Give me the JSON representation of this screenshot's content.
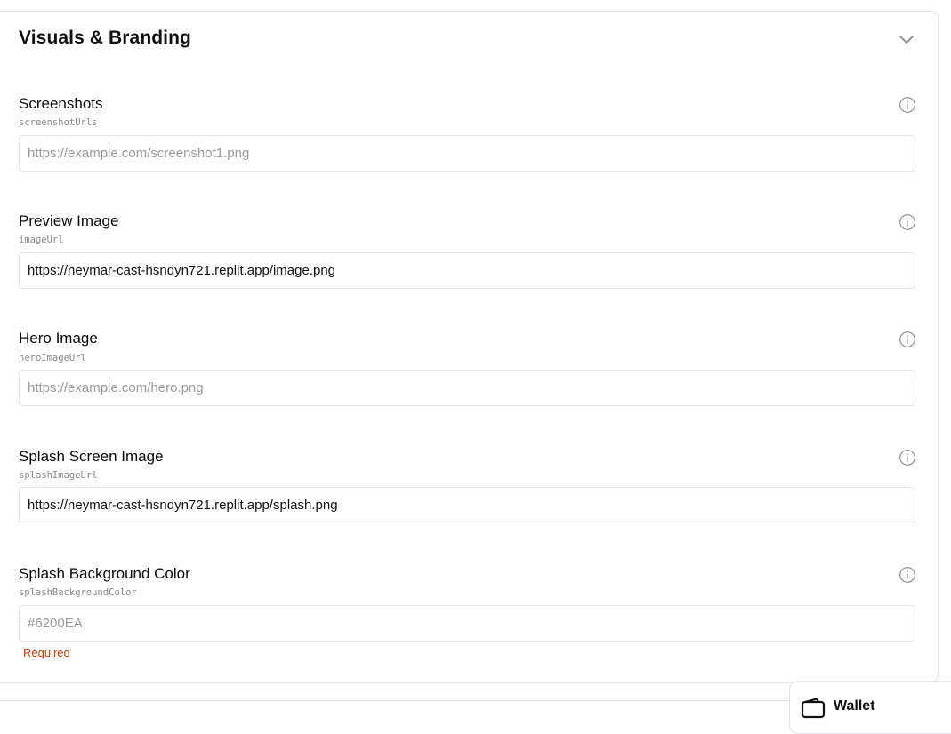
{
  "section": {
    "title": "Visuals & Branding"
  },
  "fields": [
    {
      "label": "Screenshots",
      "key": "screenshotUrls",
      "value": "",
      "placeholder": "https://example.com/screenshot1.png"
    },
    {
      "label": "Preview Image",
      "key": "imageUrl",
      "value": "https://neymar-cast-hsndyn721.replit.app/image.png",
      "placeholder": ""
    },
    {
      "label": "Hero Image",
      "key": "heroImageUrl",
      "value": "",
      "placeholder": "https://example.com/hero.png"
    },
    {
      "label": "Splash Screen Image",
      "key": "splashImageUrl",
      "value": "https://neymar-cast-hsndyn721.replit.app/splash.png",
      "placeholder": ""
    },
    {
      "label": "Splash Background Color",
      "key": "splashBackgroundColor",
      "value": "",
      "placeholder": "#6200EA",
      "error": "Required"
    }
  ],
  "wallet": {
    "label": "Wallet"
  },
  "icons": {
    "collapse": "chevron-down-icon",
    "info": "info-icon",
    "wallet": "wallet-icon"
  },
  "colors": {
    "error": "#c2410c",
    "border": "#e4e4e7",
    "placeholder": "#9a9a9a"
  }
}
